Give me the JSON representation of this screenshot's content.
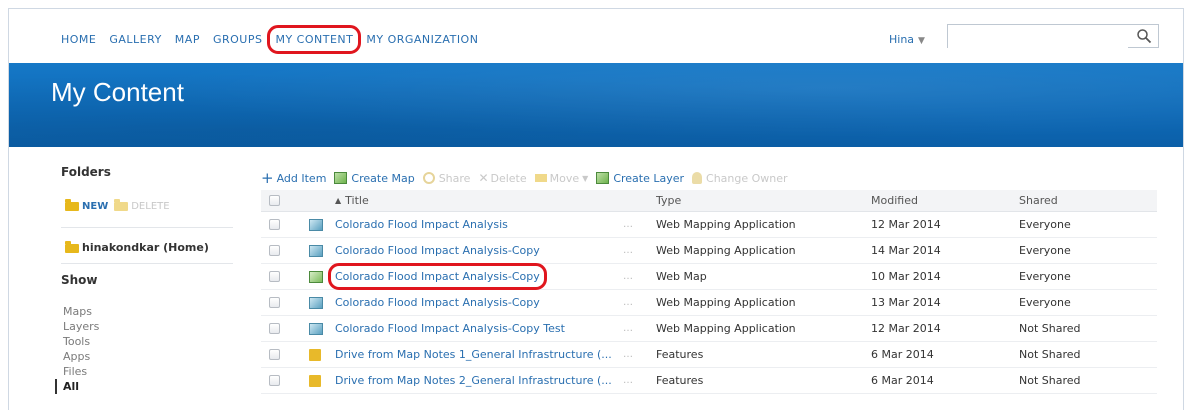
{
  "nav": {
    "links": [
      "HOME",
      "GALLERY",
      "MAP",
      "GROUPS",
      "MY CONTENT",
      "MY ORGANIZATION"
    ],
    "active_index": 4,
    "user": "Hina",
    "search_placeholder": ""
  },
  "banner": {
    "title": "My Content"
  },
  "sidebar": {
    "folders_heading": "Folders",
    "new_label": "NEW",
    "delete_label": "DELETE",
    "home_folder": "hinakondkar (Home)",
    "show_heading": "Show",
    "show_items": [
      "Maps",
      "Layers",
      "Tools",
      "Apps",
      "Files",
      "All"
    ],
    "selected_show": "All"
  },
  "toolbar": {
    "add_item": "Add Item",
    "create_map": "Create Map",
    "share": "Share",
    "delete": "Delete",
    "move": "Move",
    "create_layer": "Create Layer",
    "change_owner": "Change Owner"
  },
  "table": {
    "headers": {
      "title": "Title",
      "type": "Type",
      "modified": "Modified",
      "shared": "Shared"
    },
    "rows": [
      {
        "icon": "web-app-icon",
        "title": "Colorado Flood Impact Analysis",
        "type": "Web Mapping Application",
        "modified": "12 Mar 2014",
        "shared": "Everyone"
      },
      {
        "icon": "web-app-icon",
        "title": "Colorado Flood Impact Analysis-Copy",
        "type": "Web Mapping Application",
        "modified": "14 Mar 2014",
        "shared": "Everyone"
      },
      {
        "icon": "web-map-icon",
        "title": "Colorado Flood Impact Analysis-Copy",
        "type": "Web Map",
        "modified": "10 Mar 2014",
        "shared": "Everyone",
        "highlighted": true
      },
      {
        "icon": "web-app-icon",
        "title": "Colorado Flood Impact Analysis-Copy",
        "type": "Web Mapping Application",
        "modified": "13 Mar 2014",
        "shared": "Everyone"
      },
      {
        "icon": "web-app-icon",
        "title": "Colorado Flood Impact Analysis-Copy Test",
        "type": "Web Mapping Application",
        "modified": "12 Mar 2014",
        "shared": "Not Shared"
      },
      {
        "icon": "feature-icon",
        "title": "Drive from Map Notes 1_General Infrastructure (...",
        "type": "Features",
        "modified": "6 Mar 2014",
        "shared": "Not Shared"
      },
      {
        "icon": "feature-icon",
        "title": "Drive from Map Notes 2_General Infrastructure (...",
        "type": "Features",
        "modified": "6 Mar 2014",
        "shared": "Not Shared"
      }
    ]
  },
  "colors": {
    "link": "#2a6fb0",
    "banner": "#0e69b6",
    "highlight": "#e0161e"
  }
}
